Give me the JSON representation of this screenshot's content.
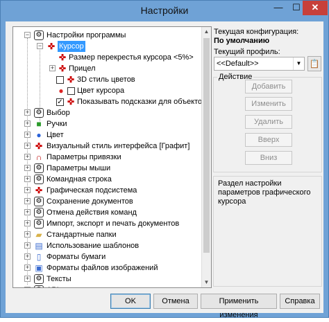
{
  "window": {
    "title": "Настройки",
    "min_glyph": "—",
    "max_glyph": "☐",
    "close_glyph": "✕"
  },
  "tree": {
    "items": [
      {
        "label": "Настройки программы",
        "icon": "gear-icon"
      },
      {
        "label": "Курсор",
        "icon": "cursor-icon",
        "selected": true
      },
      {
        "label": "Размер перекрестья курсора <5%>",
        "icon": "cursor-icon"
      },
      {
        "label": "Прицел",
        "icon": "cursor-icon"
      },
      {
        "label": "3D стиль цветов",
        "icon": "cursor-icon",
        "checked": false
      },
      {
        "label": "Цвет курсора",
        "icon": "color-icon",
        "checked": false
      },
      {
        "label": "Показывать подсказки для объектов",
        "icon": "cursor-icon",
        "checked": true
      },
      {
        "label": "Выбор",
        "icon": "gear-icon"
      },
      {
        "label": "Ручки",
        "icon": "grips-icon"
      },
      {
        "label": "Цвет",
        "icon": "color-icon"
      },
      {
        "label": "Визуальный стиль интерфейса [Графит]",
        "icon": "cursor-icon"
      },
      {
        "label": "Параметры привязки",
        "icon": "magnet-icon"
      },
      {
        "label": "Параметры мыши",
        "icon": "gear-icon"
      },
      {
        "label": "Командная строка",
        "icon": "gear-icon"
      },
      {
        "label": "Графическая подсистема",
        "icon": "cursor-icon"
      },
      {
        "label": "Сохранение документов",
        "icon": "gear-icon"
      },
      {
        "label": "Отмена действия команд",
        "icon": "gear-icon"
      },
      {
        "label": "Импорт, экспорт и печать документов",
        "icon": "gear-icon"
      },
      {
        "label": "Стандартные папки",
        "icon": "folder-icon"
      },
      {
        "label": "Использование шаблонов",
        "icon": "template-icon"
      },
      {
        "label": "Форматы бумаги",
        "icon": "paper-icon"
      },
      {
        "label": "Форматы файлов изображений",
        "icon": "image-format-icon"
      },
      {
        "label": "Тексты",
        "icon": "gear-icon"
      },
      {
        "label": "API",
        "icon": "gear-icon"
      }
    ]
  },
  "config": {
    "current_label": "Текущая конфигурация:",
    "current_value": "По умолчанию",
    "profile_label": "Текущий профиль:",
    "profile_value": "<<Default>>"
  },
  "actions": {
    "title": "Действие",
    "add": "Добавить",
    "edit": "Изменить",
    "delete": "Удалить",
    "up": "Вверх",
    "down": "Вниз"
  },
  "description": "Раздел настройки параметров графического курсора",
  "buttons": {
    "ok": "OK",
    "cancel": "Отмена",
    "apply": "Применить изменения",
    "help": "Справка"
  }
}
